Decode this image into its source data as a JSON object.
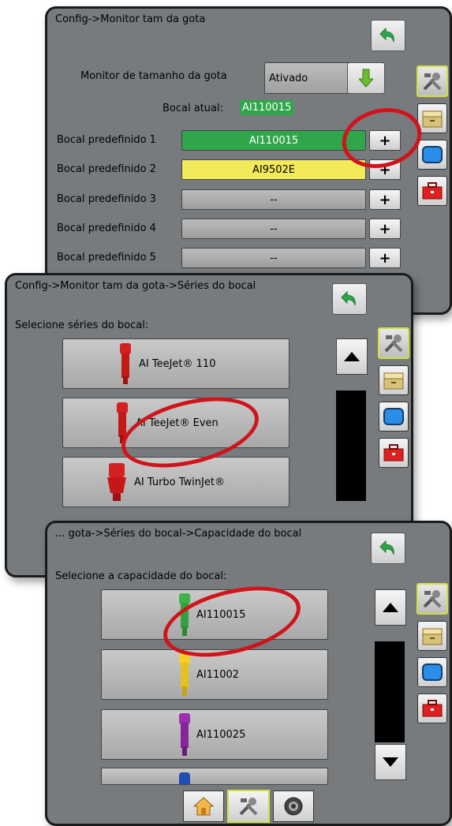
{
  "panel1": {
    "breadcrumb": "Config->Monitor tam da gota",
    "monitor_label": "Monitor de tamanho da gota",
    "monitor_value": "Ativado",
    "current_label": "Bocal atual:",
    "current_value": "AI110015",
    "presets": [
      {
        "label": "Bocal predefinido 1",
        "value": "AI110015",
        "color": "#2fa64a"
      },
      {
        "label": "Bocal predefinido 2",
        "value": "AI9502E",
        "color": "#f3ea5a"
      },
      {
        "label": "Bocal predefinido 3",
        "value": "--"
      },
      {
        "label": "Bocal predefinido 4",
        "value": "--"
      },
      {
        "label": "Bocal predefinido 5",
        "value": "--"
      }
    ],
    "plus_label": "+"
  },
  "panel2": {
    "breadcrumb": "Config->Monitor tam da gota->Séries do bocal",
    "prompt": "Selecione séries do bocal:",
    "options": [
      {
        "label": "AI TeeJet® 110"
      },
      {
        "label": "AI TeeJet® Even"
      },
      {
        "label": "AI Turbo TwinJet®"
      }
    ]
  },
  "panel3": {
    "breadcrumb": "... gota->Séries do bocal->Capacidade do bocal",
    "prompt": "Selecione a capacidade do bocal:",
    "options": [
      {
        "label": "AI110015",
        "color": "#3fb34a"
      },
      {
        "label": "AI11002",
        "color": "#f1d02c"
      },
      {
        "label": "AI110025",
        "color": "#9b2fae"
      }
    ]
  },
  "icons": {
    "back": "back-arrow-icon",
    "tools": "tools-icon",
    "folder": "folder-icon",
    "screen": "screen-icon",
    "toolbox": "toolbox-icon",
    "home": "home-icon",
    "gauge": "gauge-icon",
    "down": "down-arrow-icon"
  },
  "colors": {
    "panel_bg": "#777b7e",
    "highlight": "#d0141b",
    "active_border": "#d4e040",
    "green": "#2fa64a",
    "yellow": "#f3ea5a"
  }
}
